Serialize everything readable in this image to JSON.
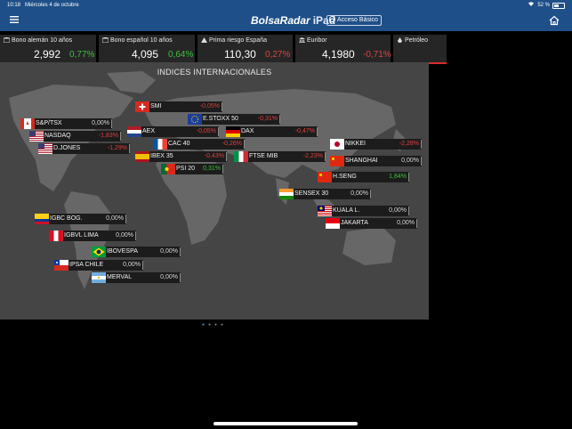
{
  "status": {
    "time": "10:18",
    "date": "Miércoles 4 de octubre",
    "battery": "52 %"
  },
  "header": {
    "menu_icon": "hamburger-icon",
    "brand": "BolsaRadar",
    "brand_suffix": "iPad",
    "access_label": "Acceso Básico",
    "home_icon": "home-icon"
  },
  "tickers": [
    {
      "name": "Bono alemán 10 años",
      "value": "2,992",
      "change": "0,77%",
      "trend": "up",
      "icon": "bond-icon"
    },
    {
      "name": "Bono español 10 años",
      "value": "4,095",
      "change": "0,64%",
      "trend": "up",
      "icon": "bond-icon"
    },
    {
      "name": "Prima riesgo España",
      "value": "110,30",
      "change": "0,27%",
      "trend": "down",
      "icon": "warning-icon"
    },
    {
      "name": "Euribor",
      "value": "4,1980",
      "change": "-0,71%",
      "trend": "down",
      "icon": "bank-icon"
    },
    {
      "name": "Petróleo",
      "value": "",
      "change": "",
      "trend": "down",
      "icon": "oil-drop-icon"
    }
  ],
  "map": {
    "title": "INDICES INTERNACIONALES",
    "indices": [
      {
        "name": "SMI",
        "change": "-0,05%",
        "trend": "down",
        "flag": "switzerland"
      },
      {
        "name": "E.STOXX 50",
        "change": "-0,31%",
        "trend": "down",
        "flag": "eu"
      },
      {
        "name": "S&P/TSX",
        "change": "0,00%",
        "trend": "flat",
        "flag": "canada"
      },
      {
        "name": "NASDAQ",
        "change": "-1,83%",
        "trend": "down",
        "flag": "usa"
      },
      {
        "name": "D.JONES",
        "change": "-1,29%",
        "trend": "down",
        "flag": "usa"
      },
      {
        "name": "AEX",
        "change": "-0,05%",
        "trend": "down",
        "flag": "netherlands"
      },
      {
        "name": "DAX",
        "change": "-0,47%",
        "trend": "down",
        "flag": "germany"
      },
      {
        "name": "CAC 40",
        "change": "-0,26%",
        "trend": "down",
        "flag": "france"
      },
      {
        "name": "IBEX 35",
        "change": "-0,43%",
        "trend": "down",
        "flag": "spain"
      },
      {
        "name": "FTSE MIB",
        "change": "-2,23%",
        "trend": "down",
        "flag": "italy"
      },
      {
        "name": "PSI 20",
        "change": "0,31%",
        "trend": "up",
        "flag": "portugal"
      },
      {
        "name": "NIKKEI",
        "change": "-2,28%",
        "trend": "down",
        "flag": "japan"
      },
      {
        "name": "SHANGHAI",
        "change": "0,00%",
        "trend": "flat",
        "flag": "china"
      },
      {
        "name": "H.SENG",
        "change": "1,84%",
        "trend": "up",
        "flag": "china"
      },
      {
        "name": "SENSEX 30",
        "change": "0,00%",
        "trend": "flat",
        "flag": "india"
      },
      {
        "name": "KUALA L.",
        "change": "0,00%",
        "trend": "flat",
        "flag": "malaysia"
      },
      {
        "name": "JAKARTA",
        "change": "0,00%",
        "trend": "flat",
        "flag": "indonesia"
      },
      {
        "name": "IGBC BOG.",
        "change": "0,00%",
        "trend": "flat",
        "flag": "colombia"
      },
      {
        "name": "IGBVL LIMA",
        "change": "0,00%",
        "trend": "flat",
        "flag": "peru"
      },
      {
        "name": "IBOVESPA",
        "change": "0,00%",
        "trend": "flat",
        "flag": "brazil"
      },
      {
        "name": "IPSA CHILE",
        "change": "0,00%",
        "trend": "flat",
        "flag": "chile"
      },
      {
        "name": "MERVAL",
        "change": "0,00%",
        "trend": "flat",
        "flag": "argentina"
      }
    ]
  },
  "pager": {
    "count": 4,
    "active": 1
  },
  "colors": {
    "accent": "#1f4f88",
    "up": "#3dc13d",
    "down": "#e04040",
    "panel": "#262626",
    "map": "#454545"
  }
}
